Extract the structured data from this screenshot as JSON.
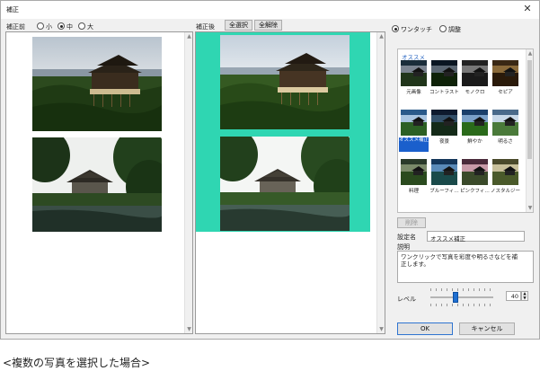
{
  "window": {
    "title": "補正",
    "close_glyph": "✕"
  },
  "before": {
    "label": "補正前",
    "size_options": [
      {
        "label": "小",
        "selected": false
      },
      {
        "label": "中",
        "selected": true
      },
      {
        "label": "大",
        "selected": false
      }
    ]
  },
  "after": {
    "label": "補正後",
    "select_all": "全選択",
    "deselect_all": "全解除"
  },
  "mode": {
    "one_touch": "ワンタッチ",
    "adjust": "調整",
    "selected": "one_touch"
  },
  "presets": {
    "group_title": "オススメ",
    "items": [
      {
        "label": "元画像",
        "tone": "original"
      },
      {
        "label": "コントラスト",
        "tone": "contrast"
      },
      {
        "label": "モノクロ",
        "tone": "mono"
      },
      {
        "label": "セピア",
        "tone": "sepia"
      },
      {
        "label": "オススメ補正",
        "tone": "recommended",
        "selected": true
      },
      {
        "label": "夜景",
        "tone": "night"
      },
      {
        "label": "鮮やか",
        "tone": "vivid"
      },
      {
        "label": "明るさ",
        "tone": "bright"
      },
      {
        "label": "料理",
        "tone": "food"
      },
      {
        "label": "ブルーフィ…",
        "tone": "blue"
      },
      {
        "label": "ピンクフィ…",
        "tone": "pink"
      },
      {
        "label": "ノスタルジー",
        "tone": "nostalgia"
      }
    ]
  },
  "delete_button": "削除",
  "setting_name": {
    "label": "設定名",
    "value": "オススメ補正"
  },
  "description": {
    "label": "説明",
    "value": "ワンクリックで写真を彩度や明るさなどを補正します。"
  },
  "level": {
    "label": "レベル",
    "value": "40",
    "fraction": 0.4
  },
  "ok": "OK",
  "cancel": "キャンセル",
  "caption": "<複数の写真を選択した場合>",
  "colors": {
    "selection": "#2fd6b2",
    "accent": "#1f6fd1"
  }
}
